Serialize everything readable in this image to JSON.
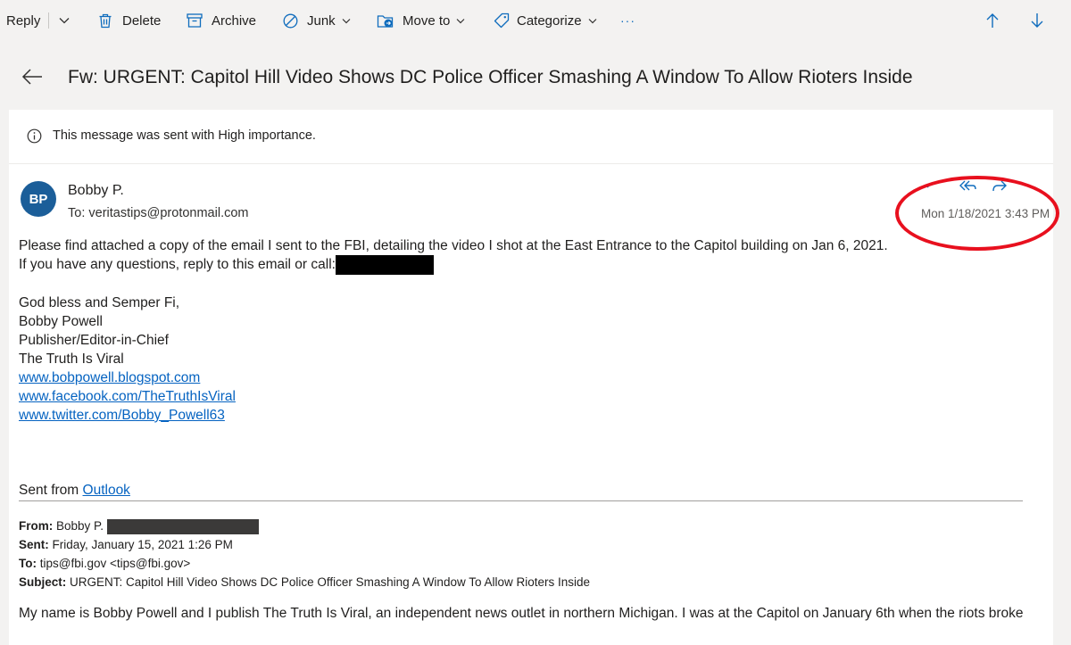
{
  "toolbar": {
    "reply": "Reply",
    "delete": "Delete",
    "archive": "Archive",
    "junk": "Junk",
    "move_to": "Move to",
    "categorize": "Categorize",
    "more": "···"
  },
  "message": {
    "subject": "Fw: URGENT: Capitol Hill Video Shows DC Police Officer Smashing A Window To Allow Rioters Inside",
    "importance_notice": "This message was sent with High importance.",
    "avatar_initials": "BP",
    "sender": "Bobby P.",
    "to_label": "To:",
    "to_address": "veritastips@protonmail.com",
    "date": "Mon 1/18/2021 3:43 PM",
    "annotation_color": "#e8101e",
    "avatar_color": "#1b5e99"
  },
  "body": {
    "line1": "Please find attached a copy of the email I sent to the FBI, detailing the video I shot at the East Entrance to the Capitol building on Jan 6, 2021.",
    "line2": "If you have any questions, reply to this email or call:",
    "closing": "God bless and Semper Fi,",
    "sig_name": "Bobby Powell",
    "sig_title": "Publisher/Editor-in-Chief",
    "sig_org": "The Truth Is Viral",
    "link_blog": "www.bobpowell.blogspot.com",
    "link_facebook": "www.facebook.com/TheTruthIsViral",
    "link_twitter": "www.twitter.com/Bobby_Powell63",
    "sent_from": "Sent from",
    "sent_from_link": "Outlook"
  },
  "forwarded": {
    "from_label": "From:",
    "from_value": "Bobby P.",
    "sent_label": "Sent:",
    "sent_value": "Friday, January 15, 2021 1:26 PM",
    "to_label": "To:",
    "to_value": "tips@fbi.gov <tips@fbi.gov>",
    "subject_label": "Subject:",
    "subject_value": "URGENT: Capitol Hill Video Shows DC Police Officer Smashing A Window To Allow Rioters Inside",
    "paragraph": "My name is Bobby Powell and I publish The Truth Is Viral, an independent news outlet in northern Michigan. I was at the Capitol on January 6th when the riots broke"
  },
  "icons": [
    "chevron-down-icon",
    "trash-icon",
    "archive-icon",
    "block-icon",
    "move-folder-icon",
    "tag-icon",
    "arrow-up-icon",
    "arrow-down-icon",
    "back-arrow-icon",
    "info-icon",
    "reply-icon",
    "reply-all-icon",
    "forward-icon"
  ]
}
